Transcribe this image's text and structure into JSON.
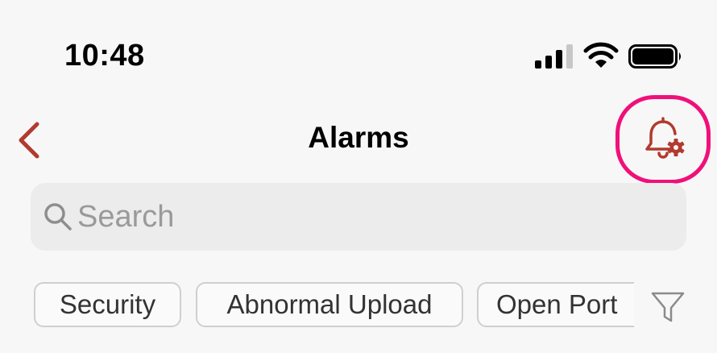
{
  "status_bar": {
    "time": "10:48",
    "icons": [
      "cellular-signal-icon",
      "wifi-icon",
      "battery-icon"
    ]
  },
  "nav": {
    "title": "Alarms",
    "back_icon": "chevron-left-icon",
    "settings_icon": "bell-gear-icon"
  },
  "search": {
    "placeholder": "Search",
    "value": ""
  },
  "filters": {
    "chips": [
      {
        "label": "Security"
      },
      {
        "label": "Abnormal Upload"
      },
      {
        "label": "Open Port"
      }
    ],
    "filter_icon": "funnel-icon"
  },
  "colors": {
    "accent": "#b23a2e",
    "highlight": "#f0107a",
    "background": "#f7f7f7"
  }
}
